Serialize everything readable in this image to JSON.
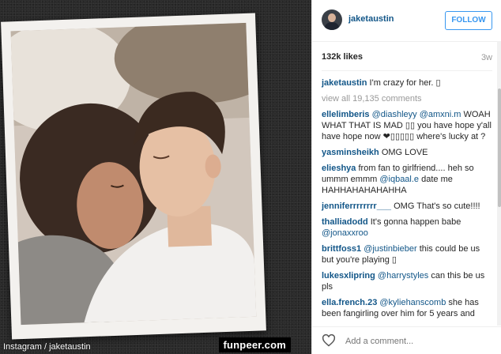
{
  "post": {
    "username": "jaketaustin",
    "follow_label": "FOLLOW",
    "likes": "132k likes",
    "time": "3w",
    "caption_user": "jaketaustin",
    "caption_text": "I'm crazy for her. ▯",
    "view_all": "view all 19,135 comments",
    "add_comment_placeholder": "Add a comment..."
  },
  "comments": [
    {
      "user": "ellelimberis",
      "mention": "@diashleyy @amxni.m",
      "text": "WOAH WHAT THAT IS MAD ▯▯ you have hope y'all have hope now ❤▯▯▯▯▯ where's lucky at ?"
    },
    {
      "user": "yasminsheikh",
      "mention": "",
      "text": "OMG LOVE"
    },
    {
      "user": "elieshya",
      "mention": "",
      "text": "from fan to girlfriend.... heh so ummm emmm",
      "mention2": "@iqbaal.e",
      "text2": "date me HAHHAHAHAHAHHA"
    },
    {
      "user": "jenniferrrrrrrr___",
      "mention": "",
      "text": "OMG That's so cute!!!!"
    },
    {
      "user": "thalliadodd",
      "mention": "",
      "text": "It's gonna happen babe",
      "mention2": "@jonaxxroo",
      "text2": ""
    },
    {
      "user": "brittfoss1",
      "mention": "@justinbieber",
      "text": "this could be us but you're playing ▯"
    },
    {
      "user": "lukesxlipring",
      "mention": "@harrystyles",
      "text": "can this be us pls"
    },
    {
      "user": "ella.french.23",
      "mention": "@kyliehanscomb",
      "text": "she has been fangirling over him for 5 years and"
    }
  ],
  "credit": "Instagram / jaketaustin",
  "watermark": "funpeer.com",
  "colors": {
    "link": "#125688",
    "follow": "#3897f0"
  }
}
